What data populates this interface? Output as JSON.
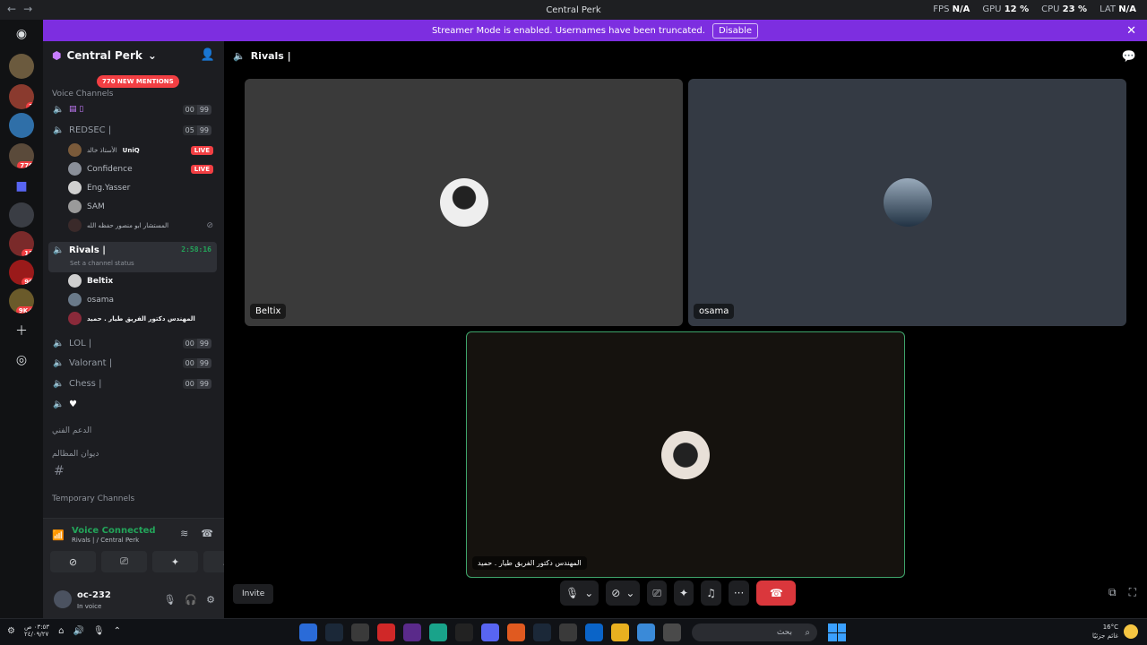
{
  "titlebar": {
    "title": "Central Perk",
    "fps_label": "FPS",
    "fps_value": "N/A",
    "gpu_label": "GPU",
    "gpu_value": "12 %",
    "cpu_label": "CPU",
    "cpu_value": "23 %",
    "lat_label": "LAT",
    "lat_value": "N/A"
  },
  "servers": {
    "badges": [
      "2",
      "770",
      "13",
      "90",
      "9K+"
    ]
  },
  "banner": {
    "text": "Streamer Mode is enabled. Usernames have been truncated.",
    "disable": "Disable"
  },
  "sidebar": {
    "guild_name": "Central Perk",
    "mentions": "770 NEW MENTIONS",
    "voice_category": "Voice Channels",
    "channels": {
      "ch1": {
        "name": "",
        "lim_a": "00",
        "lim_b": "99"
      },
      "redsec": {
        "name": "REDSEC |",
        "lim_a": "05",
        "lim_b": "99"
      },
      "rivals": {
        "name": "Rivals |",
        "timer": "2:58:16",
        "status": "Set a channel status"
      },
      "lol": {
        "name": "LOL |",
        "lim_a": "00",
        "lim_b": "99"
      },
      "valorant": {
        "name": "Valorant |",
        "lim_a": "00",
        "lim_b": "99"
      },
      "chess": {
        "name": "Chess |",
        "lim_a": "00",
        "lim_b": "99"
      }
    },
    "redsec_users": [
      {
        "name": "الأستاذ خالد",
        "extra": "UniQ",
        "live": "LIVE"
      },
      {
        "name": "Confidence",
        "live": "LIVE"
      },
      {
        "name": "Eng.Yasser"
      },
      {
        "name": "SAM"
      },
      {
        "name": "المستشار ابو منصور حفظه الله"
      }
    ],
    "rivals_users": [
      {
        "name": "Beltix"
      },
      {
        "name": "osama"
      },
      {
        "name": "المهندس دكتور الفريق طيار . حميد"
      }
    ],
    "cat_support": "الدعم الفني",
    "cat_complaints": "ديوان المظالم",
    "cat_temporary": "Temporary Channels"
  },
  "voice_panel": {
    "title": "Voice Connected",
    "sub": "Rivals | / Central Perk",
    "username": "oc-232",
    "status": "In voice"
  },
  "stage": {
    "channel": "Rivals |",
    "tiles": {
      "beltix": "Beltix",
      "osama": "osama",
      "hameed": "المهندس دكتور الفريق طيار . حميد"
    },
    "invite": "Invite"
  },
  "taskbar": {
    "time": "٠٣:٥٣ ص",
    "date": "٢٤/٠٩/٢٧",
    "search": "بحث",
    "temp": "16°C",
    "weather": "غائم جزئيًا"
  },
  "colors": {
    "banner": "#7d2ee0",
    "green": "#23a55a",
    "red": "#f23f43",
    "speaking_border": "#3ea56b"
  }
}
